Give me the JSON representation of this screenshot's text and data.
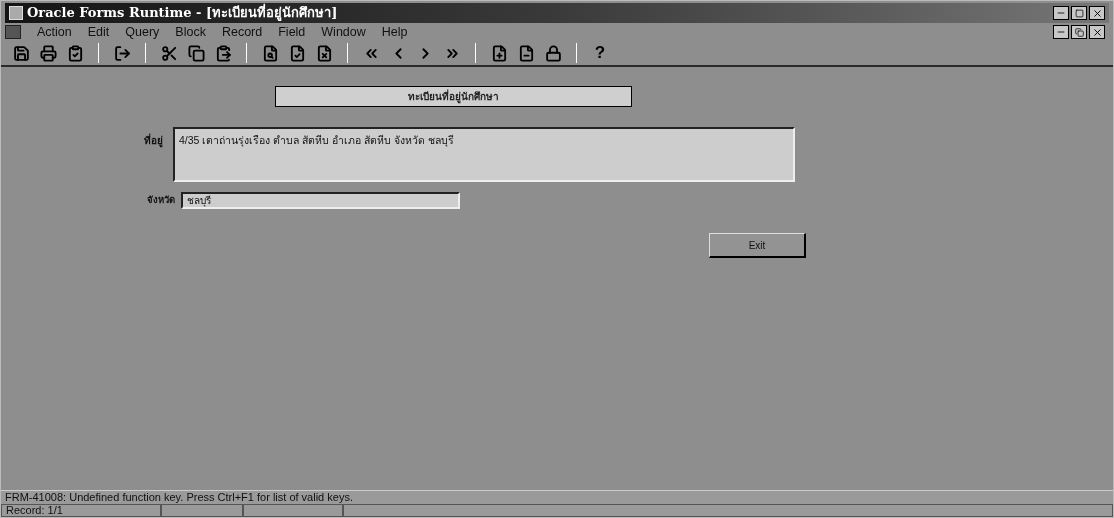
{
  "window": {
    "title": "Oracle Forms Runtime - [ทะเบียนที่อยู่นักศึกษา]"
  },
  "menu": [
    {
      "label": "Action"
    },
    {
      "label": "Edit"
    },
    {
      "label": "Query"
    },
    {
      "label": "Block"
    },
    {
      "label": "Record"
    },
    {
      "label": "Field"
    },
    {
      "label": "Window"
    },
    {
      "label": "Help"
    }
  ],
  "toolbar": [
    {
      "kind": "save"
    },
    {
      "kind": "print"
    },
    {
      "kind": "clear"
    },
    {
      "kind": "sep"
    },
    {
      "kind": "exit"
    },
    {
      "kind": "sep"
    },
    {
      "kind": "cut"
    },
    {
      "kind": "copy"
    },
    {
      "kind": "paste"
    },
    {
      "kind": "sep"
    },
    {
      "kind": "enter-query"
    },
    {
      "kind": "execute-query"
    },
    {
      "kind": "cancel-query"
    },
    {
      "kind": "sep"
    },
    {
      "kind": "first"
    },
    {
      "kind": "prev"
    },
    {
      "kind": "next"
    },
    {
      "kind": "last"
    },
    {
      "kind": "sep"
    },
    {
      "kind": "insert"
    },
    {
      "kind": "delete"
    },
    {
      "kind": "lock"
    },
    {
      "kind": "sep"
    },
    {
      "kind": "help",
      "text": "?"
    }
  ],
  "form": {
    "heading": "ทะเบียนที่อยู่นักศึกษา",
    "fields": [
      {
        "label": "ที่อยู่",
        "value": "4/35 เตาถ่านรุ่งเรือง ตำบล สัตหีบ อำเภอ สัตหีบ จังหวัด ชลบุรี",
        "kind": "multiline"
      },
      {
        "label": "จังหวัด",
        "value": "ชลบุรี",
        "kind": "single"
      }
    ],
    "button": "Exit"
  },
  "status_bar": {
    "message": "FRM-41008: Undefined function key.  Press Ctrl+F1  for list of valid keys.",
    "record": "Record: 1/1"
  }
}
